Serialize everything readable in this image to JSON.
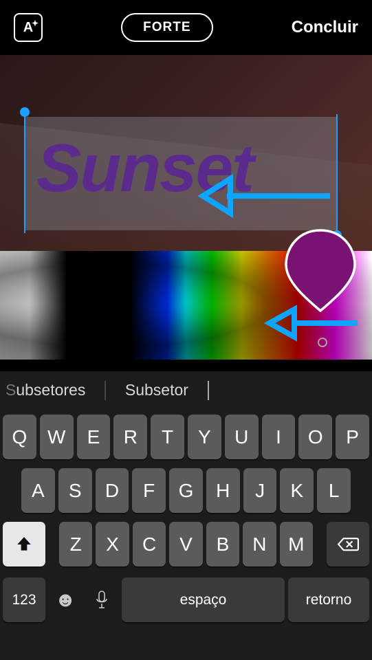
{
  "header": {
    "font_style_label": "A",
    "weight_label": "FORTE",
    "done_label": "Concluir"
  },
  "canvas": {
    "text": "Sunset",
    "text_color": "#5a2a8c",
    "selected_color": "#7a1273"
  },
  "suggestions": {
    "word1_prefix": "S",
    "word1_rest": "ubsetores",
    "word2": "Subsetor"
  },
  "keyboard": {
    "row1": [
      "Q",
      "W",
      "E",
      "R",
      "T",
      "Y",
      "U",
      "I",
      "O",
      "P"
    ],
    "row2": [
      "A",
      "S",
      "D",
      "F",
      "G",
      "H",
      "J",
      "K",
      "L"
    ],
    "row3": [
      "Z",
      "X",
      "C",
      "V",
      "B",
      "N",
      "M"
    ],
    "num_label": "123",
    "space_label": "espaço",
    "return_label": "retorno"
  }
}
